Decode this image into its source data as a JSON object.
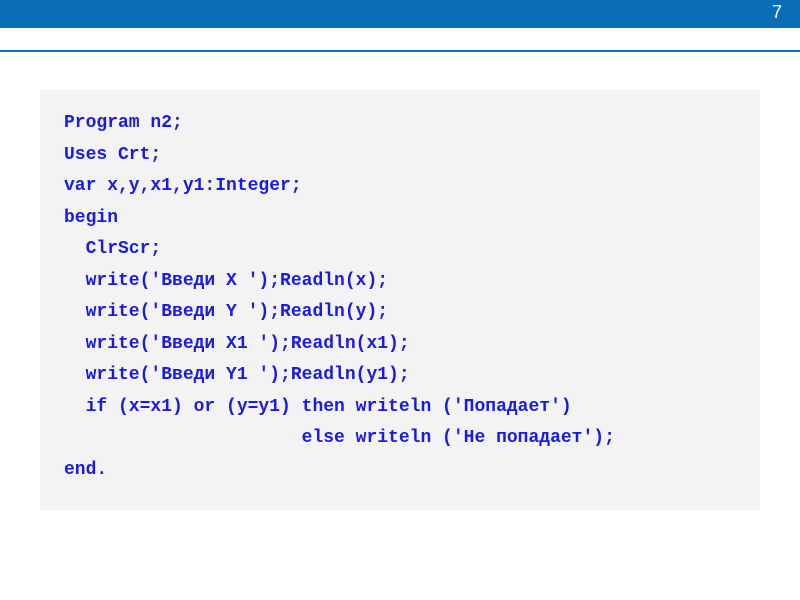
{
  "header": {
    "page_number": "7"
  },
  "code": {
    "lines": [
      "Program n2;",
      "Uses Crt;",
      "var x,y,x1,y1:Integer;",
      "begin",
      "  ClrScr;",
      "  write('Введи X ');Readln(x);",
      "  write('Введи Y ');Readln(y);",
      "  write('Введи X1 ');Readln(x1);",
      "  write('Введи Y1 ');Readln(y1);",
      "  if (x=x1) or (y=y1) then writeln ('Попадает')",
      "                      else writeln ('Не попадает');",
      "end."
    ]
  }
}
